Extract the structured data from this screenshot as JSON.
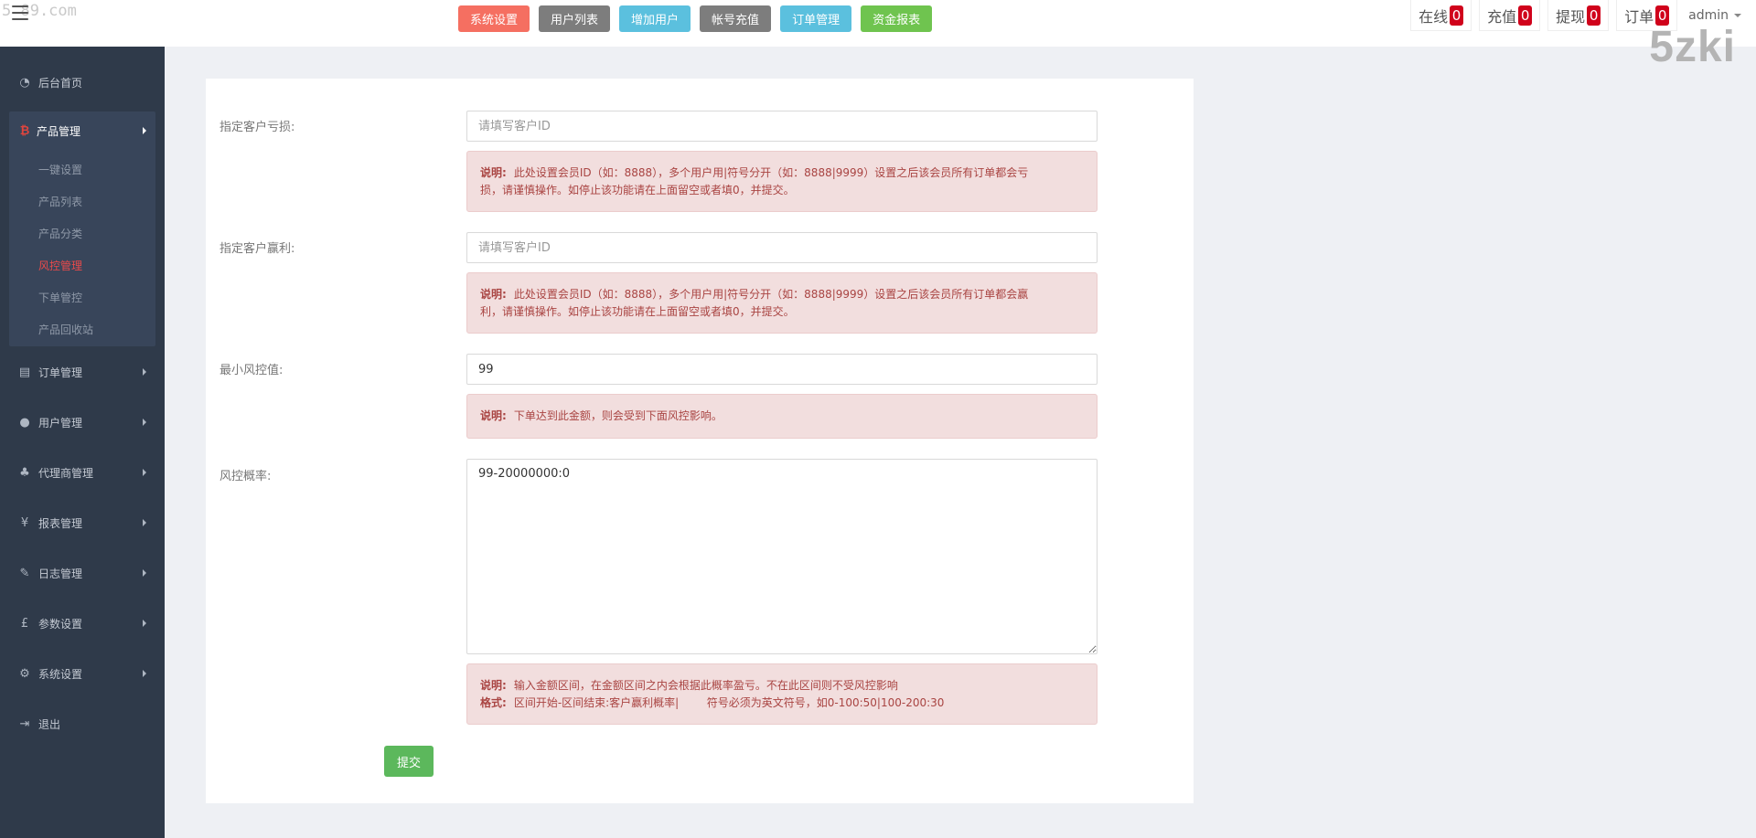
{
  "watermarks": {
    "small": "5 89.com",
    "big": "5zki"
  },
  "topbar": {
    "quick_buttons": [
      {
        "label": "系统设置",
        "color": "#f56f61"
      },
      {
        "label": "用户列表",
        "color": "#7d7d7d"
      },
      {
        "label": "增加用户",
        "color": "#5bc0de"
      },
      {
        "label": "帐号充值",
        "color": "#7d7d7d"
      },
      {
        "label": "订单管理",
        "color": "#5bc0de"
      },
      {
        "label": "资金报表",
        "color": "#6fc44f"
      }
    ],
    "counters": [
      {
        "label": "在线",
        "count": "0"
      },
      {
        "label": "充值",
        "count": "0"
      },
      {
        "label": "提现",
        "count": "0"
      },
      {
        "label": "订单",
        "count": "0"
      }
    ],
    "user": "admin"
  },
  "sidebar": {
    "home": "后台首页",
    "product_menu": {
      "label": "产品管理",
      "items": [
        "一键设置",
        "产品列表",
        "产品分类",
        "风控管理",
        "下单管控",
        "产品回收站"
      ],
      "active_item": "风控管理"
    },
    "menus": [
      "订单管理",
      "用户管理",
      "代理商管理",
      "报表管理",
      "日志管理",
      "参数设置",
      "系统设置"
    ],
    "logout": "退出"
  },
  "form": {
    "loss_user": {
      "label": "指定客户亏损:",
      "placeholder": "请填写客户ID",
      "note_title": "说明:",
      "note_line1": "此处设置会员ID（如：8888），多个用户用|符号分开（如：8888|9999）设置之后该会员所有订单都会亏",
      "note_line2": "损，请谨慎操作。如停止该功能请在上面留空或者填0，并提交。"
    },
    "win_user": {
      "label": "指定客户赢利:",
      "placeholder": "请填写客户ID",
      "note_title": "说明:",
      "note_line1": "此处设置会员ID（如：8888），多个用户用|符号分开（如：8888|9999）设置之后该会员所有订单都会赢",
      "note_line2": "利，请谨慎操作。如停止该功能请在上面留空或者填0，并提交。"
    },
    "min_risk": {
      "label": "最小风控值:",
      "value": "99",
      "note_title": "说明:",
      "note_text": "下单达到此金额，则会受到下面风控影响。"
    },
    "risk_rate": {
      "label": "风控概率:",
      "value": "99-20000000:0",
      "note_title": "说明:",
      "note_text": "输入金额区间，在金额区间之内会根据此概率盈亏。不在此区间则不受风控影响",
      "format_title": "格式:",
      "format_text": "区间开始-区间结束:客户赢利概率|        符号必须为英文符号，如0-100:50|100-200:30"
    },
    "submit_label": "提交"
  }
}
